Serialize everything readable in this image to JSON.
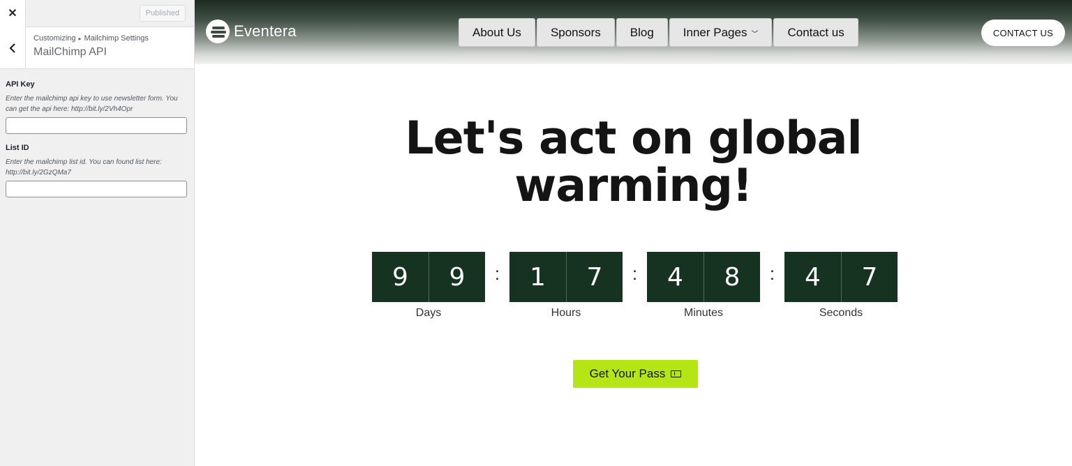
{
  "customizer": {
    "close_icon": "close-icon",
    "status_button": "Published",
    "breadcrumb": {
      "root": "Customizing",
      "section": "Mailchimp Settings"
    },
    "panel_title": "MailChimp API",
    "fields": [
      {
        "label": "API Key",
        "description": "Enter the mailchimp api key to use newsletter form. You can get the api here: http://bit.ly/2Vh4Opr",
        "value": ""
      },
      {
        "label": "List ID",
        "description": "Enter the mailchimp list id. You can found list here: http://bit.ly/2GzQMa7",
        "value": ""
      }
    ]
  },
  "site": {
    "logo_text": "Eventera",
    "nav": [
      "About Us",
      "Sponsors",
      "Blog",
      "Inner Pages",
      "Contact us"
    ],
    "cta_header": "CONTACT US",
    "headline_line1": "Let's act on global",
    "headline_line2": "warming!",
    "countdown": [
      {
        "label": "Days",
        "digits": [
          "9",
          "9"
        ]
      },
      {
        "label": "Hours",
        "digits": [
          "1",
          "7"
        ]
      },
      {
        "label": "Minutes",
        "digits": [
          "4",
          "8"
        ]
      },
      {
        "label": "Seconds",
        "digits": [
          "4",
          "7"
        ]
      }
    ],
    "colon": ":",
    "pass_button": "Get Your Pass",
    "colors": {
      "countdown_bg": "#163322",
      "accent": "#b5e514"
    }
  }
}
